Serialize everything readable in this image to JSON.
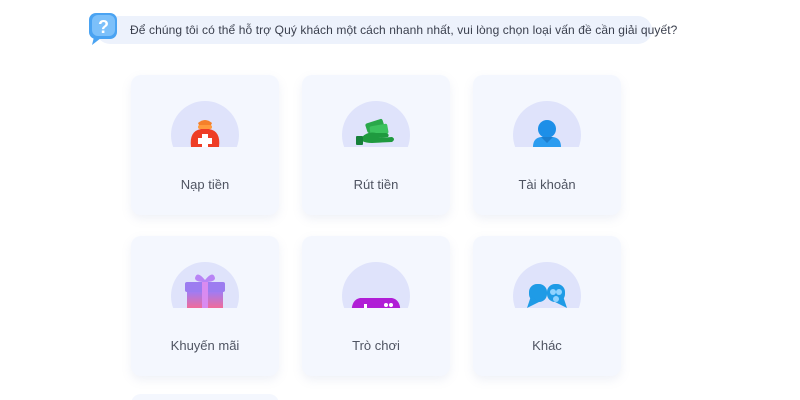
{
  "prompt": {
    "icon": "question-bubble-icon",
    "text": "Để chúng tôi có thể hỗ trợ Quý khách một cách nhanh nhất, vui lòng chọn loại vấn đề cần giải quyết?"
  },
  "categories": [
    {
      "label": "Nạp tiền",
      "icon": "money-bag-icon"
    },
    {
      "label": "Rút tiền",
      "icon": "cash-hand-icon"
    },
    {
      "label": "Tài khoản",
      "icon": "user-account-icon"
    },
    {
      "label": "Khuyến mãi",
      "icon": "gift-icon"
    },
    {
      "label": "Trò chơi",
      "icon": "gamepad-icon"
    },
    {
      "label": "Khác",
      "icon": "chat-bubbles-icon"
    }
  ],
  "colors": {
    "accent": "#2f8be8",
    "card_bg": "#f4f7fe",
    "icon_circle": "#dfe3fb"
  }
}
